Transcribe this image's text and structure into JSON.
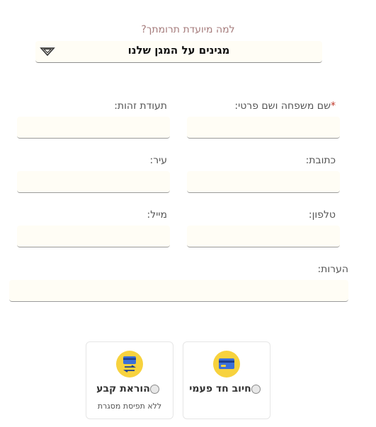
{
  "purpose": {
    "label": "למה מיועדת תרומתך?",
    "selected": "מגינים על המגן שלנו"
  },
  "form": {
    "full_name_label": "שם משפחה ושם פרטי:",
    "id_label": "תעודת זהות:",
    "address_label": "כתובת:",
    "city_label": "עיר:",
    "phone_label": "טלפון:",
    "email_label": "מייל:",
    "notes_label": "הערות:"
  },
  "payment": {
    "one_time": {
      "label": "חיוב חד פעמי",
      "icon": "credit-card-icon"
    },
    "standing_order": {
      "label": "הוראת קבע",
      "sublabel": "ללא תפיסת מסגרת",
      "icon": "recurring-card-icon"
    }
  },
  "colors": {
    "accent_yellow": "#f7d23e",
    "field_bg": "#fffdf5",
    "card_blue": "#3b6fd8",
    "purpose_label": "#a57b7b"
  }
}
